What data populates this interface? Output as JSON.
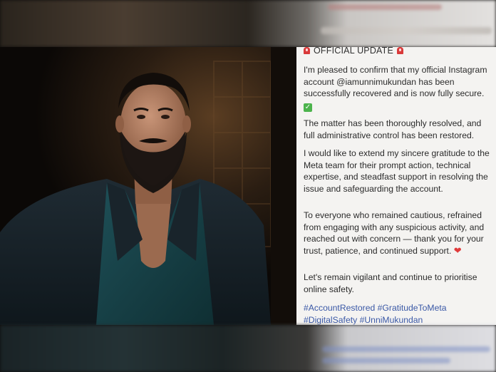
{
  "post": {
    "header": "OFFICIAL UPDATE",
    "header_icon": "siren-icon",
    "p1": "I'm pleased to confirm that my official Instagram account @iamunnimukundan has been successfully recovered and is now fully secure.",
    "p1_icon": "check-mark-icon",
    "p2": "The matter has been thoroughly resolved, and full administrative control has been restored.",
    "p3": "I would like to extend my sincere gratitude to the Meta team for their prompt action, technical expertise, and steadfast support in resolving the issue and safeguarding the account.",
    "p4": "To everyone who remained cautious, refrained from engaging with any suspicious activity, and reached out with concern — thank you for your trust, patience, and continued support.",
    "p4_icon": "heart-icon",
    "p5": "Let's remain vigilant and continue to prioritise online safety.",
    "hashtags_line1": "#AccountRestored #GratitudeToMeta",
    "hashtags_line2": "#DigitalSafety #UnniMukundan",
    "colors": {
      "background": "#f4f3f1",
      "text": "#2b2b2b",
      "hashtag": "#3a58a6",
      "heart": "#e03b3b",
      "check": "#4cb34c",
      "siren": "#d93a3a"
    }
  }
}
